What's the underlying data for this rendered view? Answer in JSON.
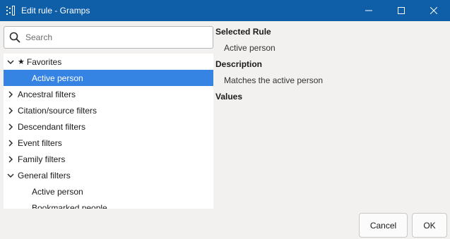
{
  "window": {
    "title": "Edit rule - Gramps",
    "app_icon": "gramps-tree-icon",
    "controls": [
      "minimize-icon",
      "maximize-icon",
      "close-icon"
    ]
  },
  "search": {
    "placeholder": "Search",
    "value": ""
  },
  "tree": {
    "favorites": {
      "label": "Favorites",
      "expanded": true
    },
    "favorites_active_person": {
      "label": "Active person",
      "selected": true
    },
    "ancestral": {
      "label": "Ancestral filters",
      "expanded": false
    },
    "citation": {
      "label": "Citation/source filters",
      "expanded": false
    },
    "descendant": {
      "label": "Descendant filters",
      "expanded": false
    },
    "event": {
      "label": "Event filters",
      "expanded": false
    },
    "family": {
      "label": "Family filters",
      "expanded": false
    },
    "general": {
      "label": "General filters",
      "expanded": true
    },
    "general_active_person": {
      "label": "Active person"
    },
    "general_bookmarked": {
      "label": "Bookmarked people"
    }
  },
  "details": {
    "selected_rule_heading": "Selected Rule",
    "selected_rule_value": "Active person",
    "description_heading": "Description",
    "description_value": "Matches the active person",
    "values_heading": "Values"
  },
  "buttons": {
    "cancel": "Cancel",
    "ok": "OK"
  },
  "colors": {
    "titlebar": "#0f5ea8",
    "selection": "#3584e4",
    "background": "#f3f1ef"
  }
}
